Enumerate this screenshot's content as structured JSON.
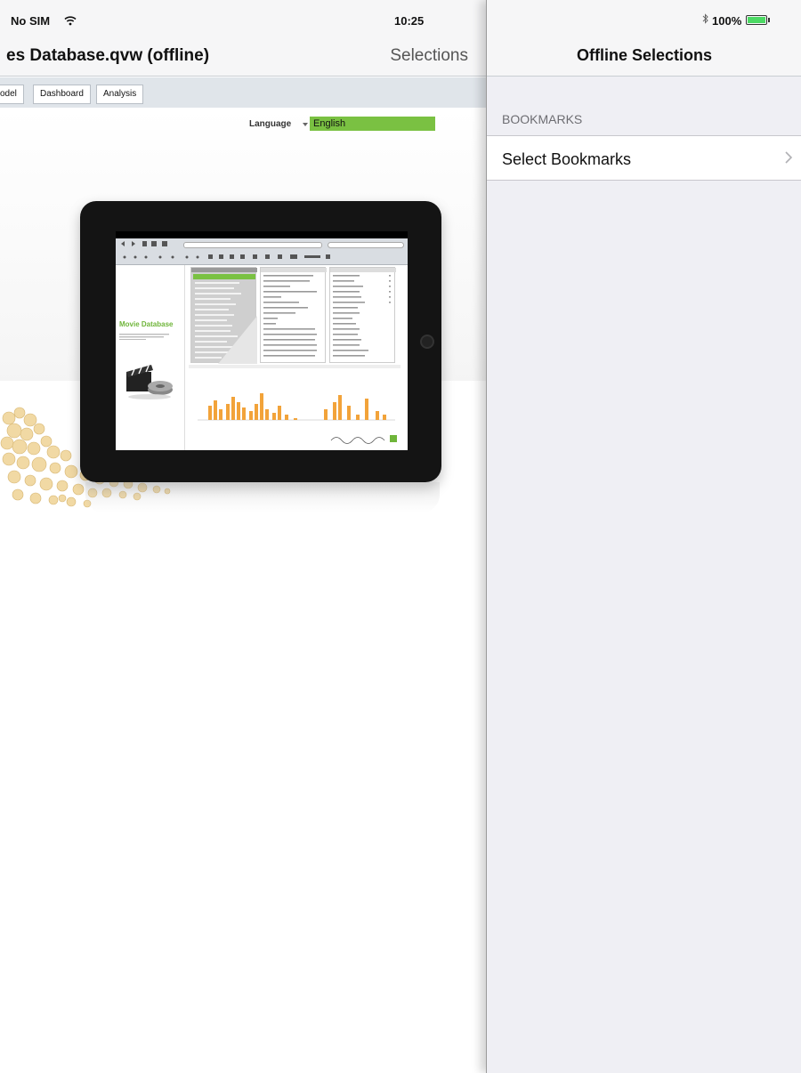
{
  "status_bar": {
    "carrier": "No SIM",
    "time": "10:25",
    "battery": "100%",
    "wifi_icon": "wifi-icon",
    "bluetooth_icon": "bluetooth-icon"
  },
  "document": {
    "title": "es Database.qvw (offline)",
    "selections_button": "Selections",
    "tabs": [
      {
        "label": "odel"
      },
      {
        "label": "Dashboard"
      },
      {
        "label": "Analysis"
      }
    ],
    "language_label": "Language",
    "language_value": "English"
  },
  "illustration": {
    "app_title": "Movie Database"
  },
  "panel": {
    "title": "Offline Selections",
    "section_header": "BOOKMARKS",
    "rows": [
      {
        "label": "Select Bookmarks",
        "icon": "chevron-right-icon"
      }
    ]
  },
  "colors": {
    "accent_green": "#7ac142",
    "battery_green": "#4cd964",
    "panel_bg": "#efeff4"
  }
}
